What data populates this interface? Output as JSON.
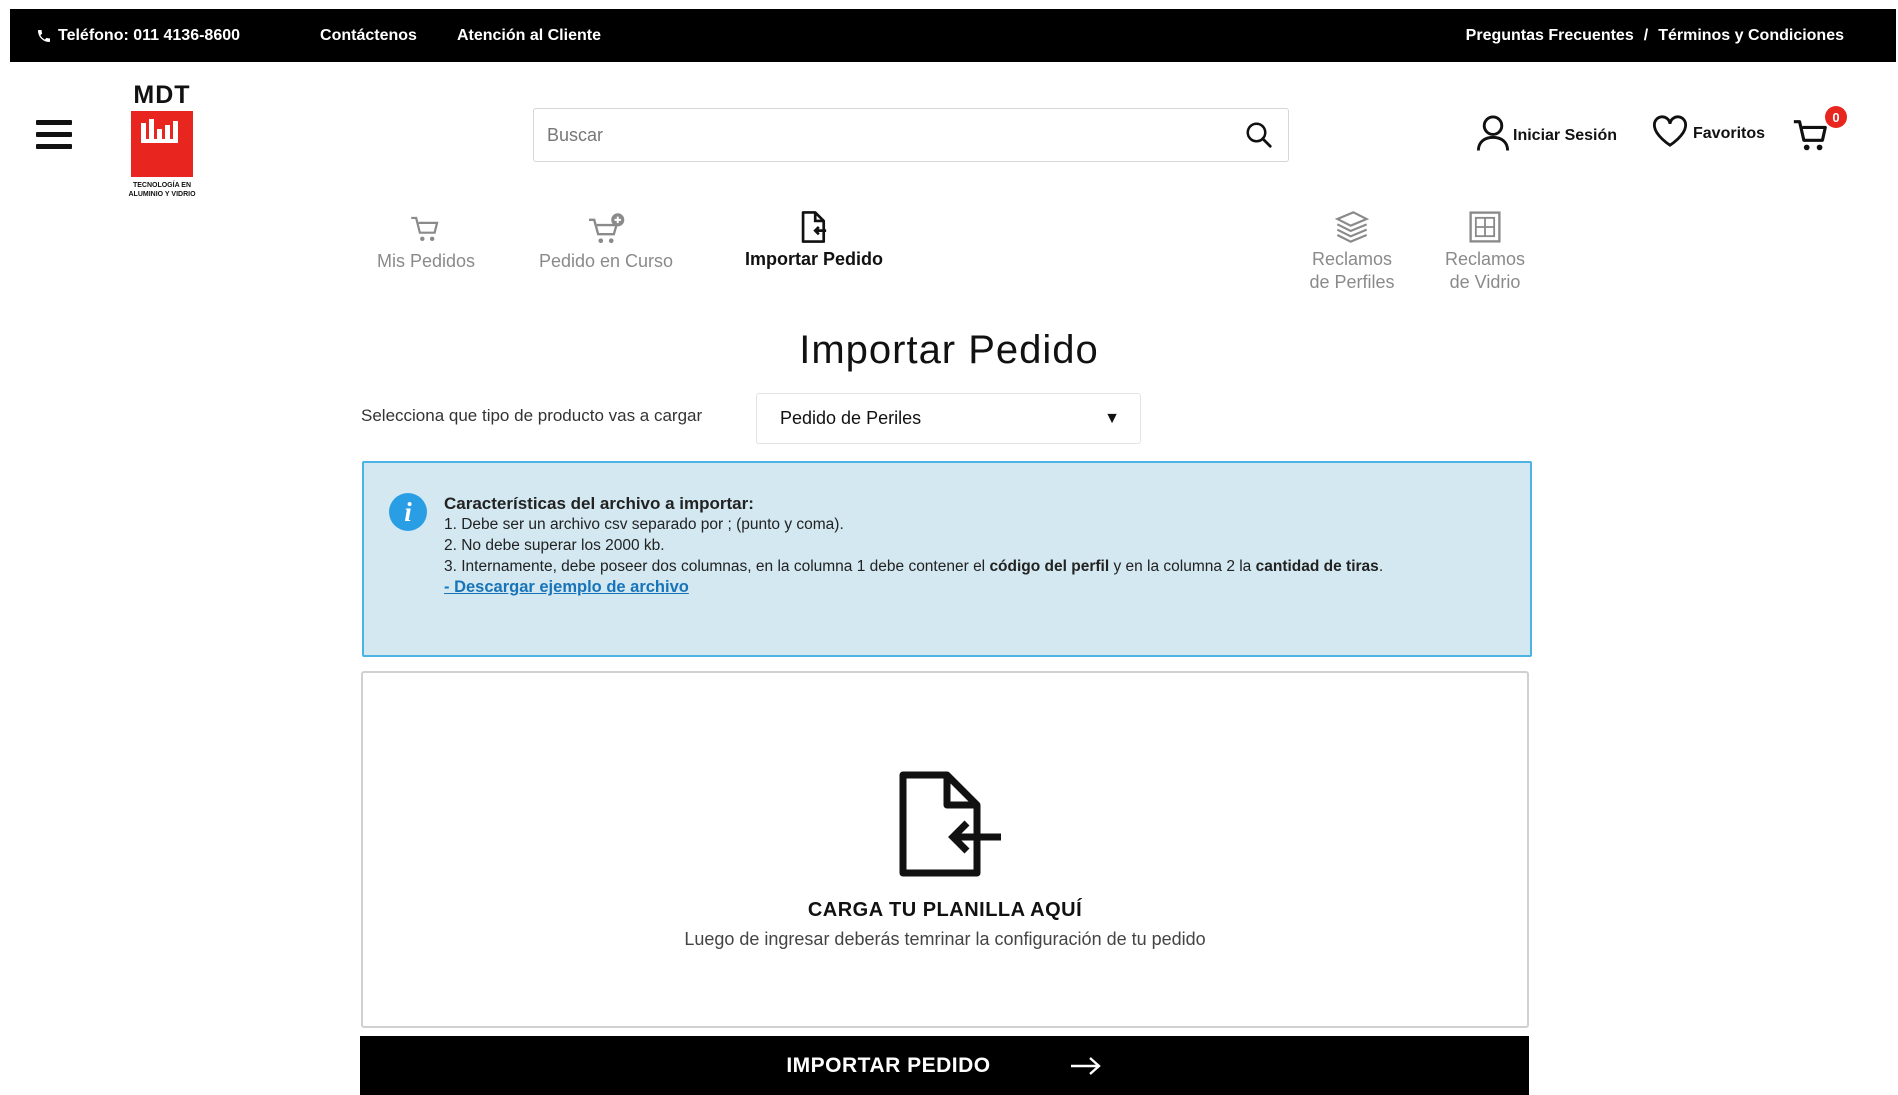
{
  "topbar": {
    "phone": "Teléfono: 011 4136-8600",
    "contact": "Contáctenos",
    "customer_service": "Atención al Cliente",
    "faq": "Preguntas Frecuentes",
    "separator": "/",
    "terms": "Términos y Condiciones"
  },
  "logo": {
    "name": "MDT",
    "tagline_1": "TECNOLOGÍA EN",
    "tagline_2": "ALUMINIO Y VIDRIO",
    "color": "#e8261f"
  },
  "search": {
    "placeholder": "Buscar",
    "icon": "search-icon"
  },
  "account": {
    "login": "Iniciar Sesión",
    "favorites": "Favoritos",
    "cart_count": "0"
  },
  "nav": {
    "my_orders": "Mis Pedidos",
    "current_order": "Pedido en Curso",
    "import_order": "Importar Pedido",
    "profile_claims_1": "Reclamos",
    "profile_claims_2": "de Perfiles",
    "glass_claims_1": "Reclamos",
    "glass_claims_2": "de Vidrio"
  },
  "main": {
    "title": "Importar Pedido",
    "select_label": "Selecciona que tipo de producto vas a cargar",
    "select_value": "Pedido de Periles",
    "info": {
      "title": "Características del archivo a importar:",
      "line1": "1. Debe ser un archivo csv separado por ; (punto y coma).",
      "line2": "2. No debe superar los 2000 kb.",
      "line3_a": "3. Internamente, debe poseer dos columnas, en la columna 1 debe contener el ",
      "line3_b": "código del perfil",
      "line3_c": " y en la columna 2 la ",
      "line3_d": "cantidad de tiras",
      "line3_e": ".",
      "link": "- Descargar ejemplo de archivo"
    },
    "dropzone": {
      "title": "CARGA TU PLANILLA AQUÍ",
      "subtitle": "Luego de ingresar deberás temrinar la configuración de tu pedido"
    },
    "import_button": "IMPORTAR PEDIDO"
  },
  "colors": {
    "accent": "#e8261f",
    "info_bg": "#d3e8f1",
    "info_border": "#4db2e4",
    "info_icon": "#2a9ee4",
    "link": "#1874b8"
  }
}
